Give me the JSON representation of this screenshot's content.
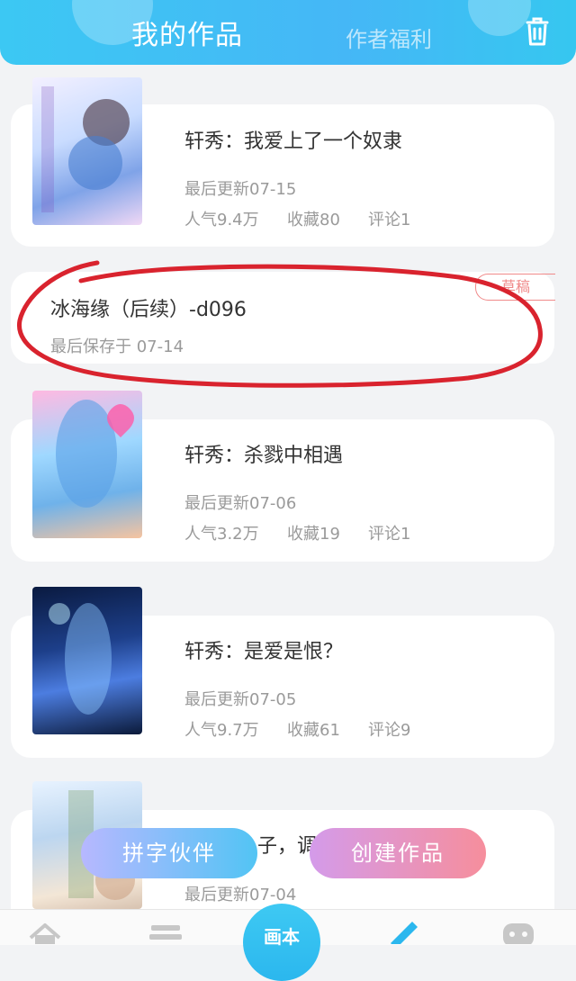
{
  "header": {
    "tab_my_works": "我的作品",
    "tab_author_benefits": "作者福利",
    "trash_icon": "trash-icon",
    "gradient_start": "#3cc8f3",
    "gradient_end": "#36c7f0"
  },
  "works": [
    {
      "title": "轩秀：我爱上了一个奴隶",
      "updated": "最后更新07-15",
      "popularity": "人气9.4万",
      "favorites": "收藏80",
      "comments": "评论1"
    },
    {
      "title": "轩秀：杀戮中相遇",
      "updated": "最后更新07-06",
      "popularity": "人气3.2万",
      "favorites": "收藏19",
      "comments": "评论1"
    },
    {
      "title": "轩秀：是爱是恨？",
      "updated": "最后更新07-05",
      "popularity": "人气9.7万",
      "favorites": "收藏61",
      "comments": "评论9"
    },
    {
      "title_partial": "子，调",
      "updated": "最后更新07-04"
    }
  ],
  "draft": {
    "title": "冰海缘（后续）-d096",
    "saved": "最后保存于 07-14",
    "badge": "草稿",
    "badge_color": "#f08a8a"
  },
  "actions": {
    "partner": "拼字伙伴",
    "create": "创建作品"
  },
  "bottom_nav": {
    "center_label": "画本",
    "icons": [
      "home-icon",
      "books-icon",
      "pen-icon",
      "chat-icon"
    ]
  },
  "annotation_color": "#d9232e"
}
